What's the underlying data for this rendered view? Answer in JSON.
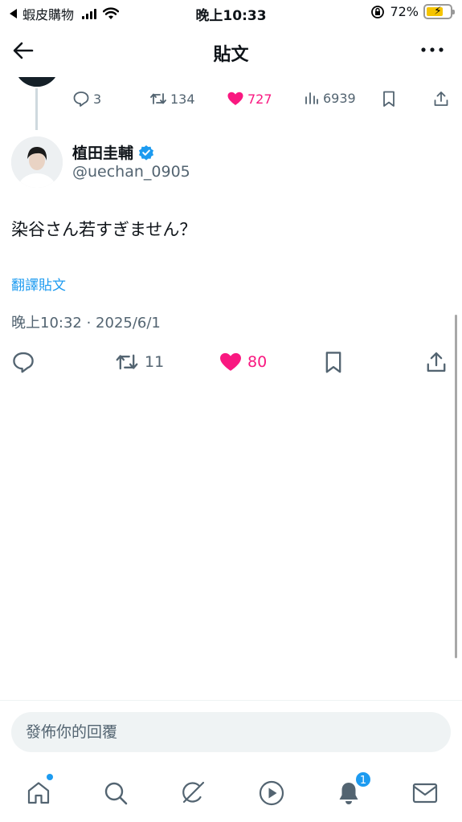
{
  "status_bar": {
    "back_app": "蝦皮購物",
    "time": "晚上10:33",
    "battery": "72%"
  },
  "header": {
    "title": "貼文"
  },
  "previous_tweet": {
    "replies": "3",
    "retweets": "134",
    "likes": "727",
    "views": "6939"
  },
  "tweet": {
    "author_name": "植田圭輔",
    "author_handle": "@uechan_0905",
    "text": "染谷さん若すぎません？",
    "translate_label": "翻譯貼文",
    "timestamp": "晚上10:32 · 2025/6/1",
    "retweets": "11",
    "likes": "80"
  },
  "reply": {
    "placeholder": "發佈你的回覆"
  },
  "tabbar": {
    "notifications_badge": "1"
  },
  "colors": {
    "accent": "#1d9bf0",
    "like": "#f91880",
    "muted": "#536471"
  }
}
